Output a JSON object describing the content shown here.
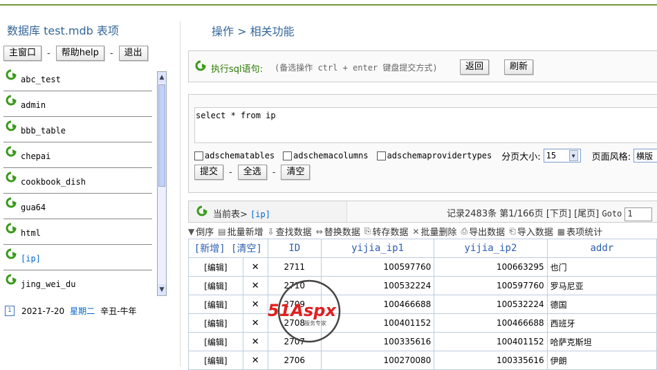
{
  "sidebar": {
    "db_title": "数据库 test.mdb 表项",
    "buttons": {
      "main": "主窗口",
      "help": "帮助help",
      "exit": "退出"
    },
    "separator": "-",
    "tables": [
      {
        "name": "abc_test",
        "active": false
      },
      {
        "name": "admin",
        "active": false
      },
      {
        "name": "bbb_table",
        "active": false
      },
      {
        "name": "chepai",
        "active": false
      },
      {
        "name": "cookbook_dish",
        "active": false
      },
      {
        "name": "gua64",
        "active": false
      },
      {
        "name": "html",
        "active": false
      },
      {
        "name": "[ip]",
        "active": true
      },
      {
        "name": "jing_wei_du",
        "active": false
      }
    ],
    "date": "2021-7-20",
    "weekday": "星期二",
    "lunar": "辛丑-牛年",
    "calendar_glyph": "1"
  },
  "breadcrumb": "操作 > 相关功能",
  "sql": {
    "label": "执行sql语句:",
    "hint": "(备选操作 ctrl + enter 键盘提交方式)",
    "back_button": "返回",
    "refresh_button": "刷新",
    "query": "select * from ip",
    "options": [
      "adschematables",
      "adschemacolumns",
      "adschemaprovidertypes"
    ],
    "page_size_label": "分页大小:",
    "page_size_value": "15",
    "page_style_label": "页面风格:",
    "page_style_value": "横版",
    "submit_button": "提交",
    "select_all_button": "全选",
    "clear_button": "清空"
  },
  "current": {
    "label": "当前表>",
    "table": "[ip]",
    "records": "记录2483条 第1/166页 [下页] [尾页] ",
    "goto_label": "Goto",
    "goto_value": "1"
  },
  "toolbar": [
    {
      "glyph": "▼",
      "label": "倒序",
      "icon": "sort-desc-icon"
    },
    {
      "glyph": "▤",
      "label": "批量新增",
      "icon": "batch-add-icon"
    },
    {
      "glyph": "⇩",
      "label": "查找数据",
      "icon": "find-icon"
    },
    {
      "glyph": "⇔",
      "label": "替换数据",
      "icon": "replace-icon"
    },
    {
      "glyph": "⎘",
      "label": "转存数据",
      "icon": "dump-icon"
    },
    {
      "glyph": "✕",
      "label": "批量删除",
      "icon": "batch-delete-icon"
    },
    {
      "glyph": "⎙",
      "label": "导出数据",
      "icon": "export-icon"
    },
    {
      "glyph": "⎗",
      "label": "导入数据",
      "icon": "import-icon"
    },
    {
      "glyph": "▦",
      "label": "表项统计",
      "icon": "stats-icon"
    }
  ],
  "grid": {
    "header": {
      "actions": "[新增] [清空]",
      "id": "ID",
      "y1": "yijia_ip1",
      "y2": "yijia_ip2",
      "addr": "addr"
    },
    "edit_label": "[编辑]",
    "delete_glyph": "✕",
    "rows": [
      {
        "id": "2711",
        "y1": "100597760",
        "y2": "100663295",
        "addr": "也门"
      },
      {
        "id": "2710",
        "y1": "100532224",
        "y2": "100597760",
        "addr": "罗马尼亚"
      },
      {
        "id": "2709",
        "y1": "100466688",
        "y2": "100532224",
        "addr": "德国"
      },
      {
        "id": "2708",
        "y1": "100401152",
        "y2": "100466688",
        "addr": "西班牙"
      },
      {
        "id": "2707",
        "y1": "100335616",
        "y2": "100401152",
        "addr": "哈萨克斯坦"
      },
      {
        "id": "2706",
        "y1": "100270080",
        "y2": "100335616",
        "addr": "伊朗"
      }
    ]
  },
  "watermark": {
    "brand": "51Aspx",
    "sub": "服务专家"
  },
  "colors": {
    "accent": "#336699",
    "green": "#2a7a00",
    "link": "#0066cc",
    "delete": "#e07a10",
    "topline": "#6f9a3a"
  }
}
